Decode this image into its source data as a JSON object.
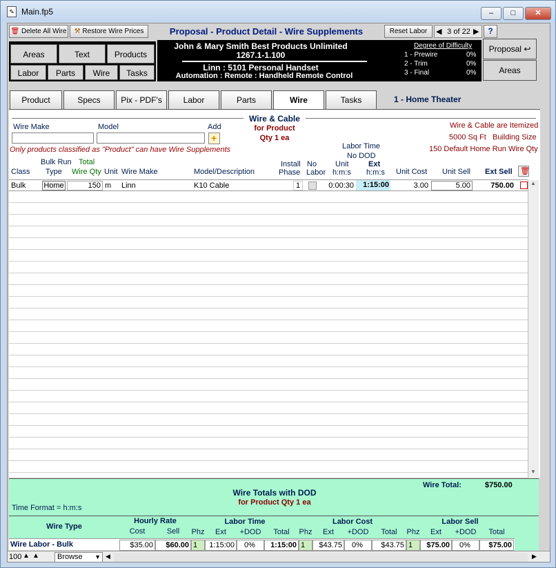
{
  "window": {
    "title": "Main.fp5",
    "min": "–",
    "max": "□",
    "close": "✕"
  },
  "toolbar": {
    "delete_all_wire": "Delete All Wire",
    "restore_wire_prices": "Restore Wire Prices",
    "page_title": "Proposal - Product Detail - Wire Supplements",
    "reset_labor": "Reset Labor",
    "record_counter": "3 of 22",
    "help": "?"
  },
  "nav": {
    "areas": "Areas",
    "text": "Text",
    "products": "Products",
    "labor": "Labor",
    "parts": "Parts",
    "wire": "Wire",
    "tasks": "Tasks"
  },
  "header": {
    "client_line": "John & Mary Smith  Best Products Unlimited",
    "job_number": "1267.1-1.100",
    "product_line": "Linn : 5101 Personal Handset",
    "category_line": "Automation : Remote : Handheld Remote Control"
  },
  "difficulty": {
    "title": "Degree of Difficulty",
    "rows": [
      {
        "label": "1 - Prewire",
        "value": "0%"
      },
      {
        "label": "2 - Trim",
        "value": "0%"
      },
      {
        "label": "3 - Final",
        "value": "0%"
      }
    ]
  },
  "right_nav": {
    "proposal": "Proposal",
    "areas": "Areas"
  },
  "tabs": [
    "Product",
    "Specs",
    "Pix - PDF's",
    "Labor",
    "Parts",
    "Wire",
    "Tasks"
  ],
  "area_name": "1 - Home Theater",
  "wire_section": {
    "title": "Wire & Cable",
    "for_product": "for Product",
    "qty": "Qty 1 ea",
    "wire_make_label": "Wire Make",
    "model_label": "Model",
    "add_label": "Add",
    "note": "Only products classified as \"Product\" can have Wire Supplements",
    "itemized": "Wire & Cable are Itemized",
    "sqft": "5000 Sq Ft",
    "building_size": "Building Size",
    "home_run": "150 Default Home Run Wire Qty",
    "labor_time": "Labor Time",
    "no_dod": "No DOD"
  },
  "columns": {
    "class": "Class",
    "bulk_run": "Bulk Run",
    "type": "Type",
    "total": "Total",
    "wire_qty": "Wire Qty",
    "unit": "Unit",
    "wire_make": "Wire Make",
    "model": "Model/Description",
    "install": "Install",
    "phase": "Phase",
    "no": "No",
    "labor": "Labor",
    "unit_hms_1": "Unit",
    "unit_hms_2": "h:m:s",
    "ext_hms_1": "Ext",
    "ext_hms_2": "h:m:s",
    "unit_cost": "Unit Cost",
    "unit_sell": "Unit Sell",
    "ext_sell": "Ext Sell"
  },
  "rows": [
    {
      "class": "Bulk",
      "type": "Home",
      "qty": "150",
      "unit": "m",
      "make": "Linn",
      "model": "K10 Cable",
      "phase": "1",
      "unit_time": "0:00:30",
      "ext_time": "1:15:00",
      "unit_cost": "3.00",
      "unit_sell": "5.00",
      "ext_sell": "750.00"
    }
  ],
  "totals": {
    "title": "Wire Totals with DOD",
    "sub": "for Product Qty 1 ea",
    "wire_total_label": "Wire Total:",
    "wire_total_value": "$750.00",
    "time_format": "Time Format = h:m:s"
  },
  "summary": {
    "wire_type": "Wire Type",
    "hourly_rate": "Hourly Rate",
    "cost": "Cost",
    "sell": "Sell",
    "labor_time": "Labor Time",
    "labor_cost": "Labor Cost",
    "labor_sell": "Labor Sell",
    "phz": "Phz",
    "ext": "Ext",
    "dod": "+DOD",
    "total": "Total",
    "row": {
      "name": "Wire Labor - Bulk",
      "rate_cost": "$35.00",
      "rate_sell": "$60.00",
      "lt_phz": "1",
      "lt_ext": "1:15:00",
      "lt_dod": "0%",
      "lt_total": "1:15:00",
      "lc_phz": "1",
      "lc_ext": "$43.75",
      "lc_dod": "0%",
      "lc_total": "$43.75",
      "ls_phz": "1",
      "ls_ext": "$75.00",
      "ls_dod": "0%",
      "ls_total": "$75.00"
    }
  },
  "status": {
    "zoom": "100",
    "mode": "Browse"
  }
}
